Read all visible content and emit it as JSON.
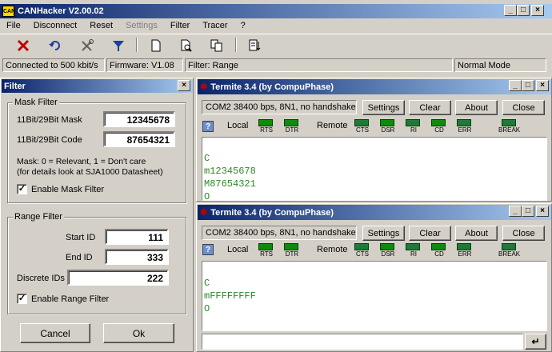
{
  "app": {
    "title": "CANHacker V2.00.02",
    "icon": "can-hacker-icon"
  },
  "menu": [
    "File",
    "Disconnect",
    "Reset",
    "Settings",
    "Filter",
    "Tracer",
    "?"
  ],
  "status": {
    "connection": "Connected to 500 kbit/s",
    "firmware": "Firmware: V1.08",
    "filter": "Filter: Range",
    "mode": "Normal Mode"
  },
  "filter_panel": {
    "title": "Filter",
    "mask_group": "Mask Filter",
    "mask_label": "11Bit/29Bit Mask",
    "mask_value": "12345678",
    "code_label": "11Bit/29Bit Code",
    "code_value": "87654321",
    "mask_note1": "Mask: 0 = Relevant, 1 = Don't care",
    "mask_note2": "(for details look at SJA1000 Datasheet)",
    "enable_mask": "Enable Mask Filter",
    "range_group": "Range Filter",
    "start_label": "Start ID",
    "start_value": "111",
    "end_label": "End ID",
    "end_value": "333",
    "discrete_label": "Discrete IDs",
    "discrete_value": "222",
    "enable_range": "Enable Range Filter",
    "cancel": "Cancel",
    "ok": "Ok"
  },
  "termite1": {
    "title": "Termite 3.4 (by CompuPhase)",
    "port": "COM2 38400 bps, 8N1, no handshake",
    "settings": "Settings",
    "clear": "Clear",
    "about": "About",
    "close": "Close",
    "local": "Local",
    "remote": "Remote",
    "help": "?",
    "lines": [
      "C",
      "m12345678",
      "M87654321",
      "O"
    ]
  },
  "termite2": {
    "title": "Termite 3.4 (by CompuPhase)",
    "port": "COM2 38400 bps, 8N1, no handshake",
    "settings": "Settings",
    "clear": "Clear",
    "about": "About",
    "close": "Close",
    "local": "Local",
    "remote": "Remote",
    "help": "?",
    "lines": [
      "C",
      "mFFFFFFFF",
      "O"
    ],
    "enter": "↵"
  },
  "leds": {
    "rts": "RTS",
    "dtr": "DTR",
    "cts": "CTS",
    "dsr": "DSR",
    "ri": "RI",
    "cd": "CD",
    "err": "ERR",
    "brk": "BREAK"
  },
  "window_buttons": {
    "min": "_",
    "max": "□",
    "close": "×"
  }
}
